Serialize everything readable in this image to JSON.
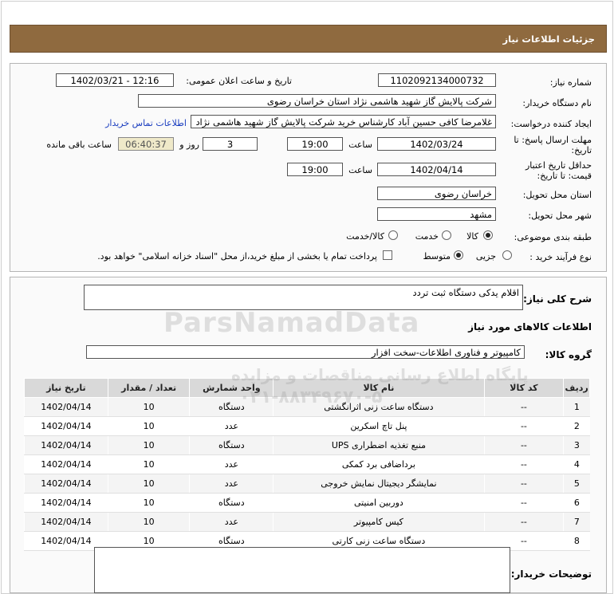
{
  "header": {
    "title": "جزئیات اطلاعات نیاز"
  },
  "form": {
    "need_number_label": "شماره نیاز:",
    "need_number": "1102092134000732",
    "announce_label": "تاریخ و ساعت اعلان عمومی:",
    "announce_value": "1402/03/21 - 12:16",
    "buyer_label": "نام دستگاه خریدار:",
    "buyer_value": "شرکت پالایش گاز شهید هاشمی نژاد   استان خراسان رضوی",
    "creator_label": "ایجاد کننده درخواست:",
    "creator_value": "غلامرضا کافی حسین آباد کارشناس خرید  شرکت پالایش گاز شهید هاشمی نژاد",
    "contact_link": "اطلاعات تماس خریدار",
    "deadline_label_1": "مهلت ارسال پاسخ: تا",
    "deadline_label_2": "تاریخ:",
    "deadline_date": "1402/03/24",
    "time_label": "ساعت",
    "deadline_time": "19:00",
    "days_value": "3",
    "days_label": "روز و",
    "remaining_time": "06:40:37",
    "remaining_label": "ساعت باقی مانده",
    "validity_label_1": "حداقل تاریخ اعتبار",
    "validity_label_2": "قیمت: تا تاریخ:",
    "validity_date": "1402/04/14",
    "validity_time": "19:00",
    "province_label": "استان محل تحویل:",
    "province_value": "خراسان رضوی",
    "city_label": "شهر محل تحویل:",
    "city_value": "مشهد",
    "category_label": "طبقه بندی موضوعی:",
    "category_options": [
      "کالا",
      "خدمت",
      "کالا/خدمت"
    ],
    "process_label": "نوع فرآیند خرید :",
    "process_options": [
      "جزیی",
      "متوسط"
    ],
    "payment_note": "پرداخت تمام یا بخشی از مبلغ خرید،از محل \"اسناد خزانه اسلامی\" خواهد بود."
  },
  "summary": {
    "desc_label": "شرح کلی نیاز:",
    "desc_value": "اقلام یدکی دستگاه ثبت تردد",
    "items_info_label": "اطلاعات کالاهای مورد نیاز",
    "group_label": "گروه کالا:",
    "group_value": "کامپیوتر و فناوری اطلاعات-سخت افزار",
    "columns": [
      "ردیف",
      "کد کالا",
      "نام کالا",
      "واحد شمارش",
      "تعداد / مقدار",
      "تاریخ نیاز"
    ],
    "rows": [
      [
        "1",
        "--",
        "دستگاه ساعت زنی اثرانگشتی",
        "دستگاه",
        "10",
        "1402/04/14"
      ],
      [
        "2",
        "--",
        "پنل تاچ اسکرین",
        "عدد",
        "10",
        "1402/04/14"
      ],
      [
        "3",
        "--",
        "منبع تغذیه اضطراری UPS",
        "دستگاه",
        "10",
        "1402/04/14"
      ],
      [
        "4",
        "--",
        "برداضافی برد کمکی",
        "عدد",
        "10",
        "1402/04/14"
      ],
      [
        "5",
        "--",
        "نمایشگر دیجیتال نمایش خروجی",
        "عدد",
        "10",
        "1402/04/14"
      ],
      [
        "6",
        "--",
        "دوربین امنیتی",
        "دستگاه",
        "10",
        "1402/04/14"
      ],
      [
        "7",
        "--",
        "کیس کامپیوتر",
        "عدد",
        "10",
        "1402/04/14"
      ],
      [
        "8",
        "--",
        "دستگاه ساعت زنی کارتی",
        "دستگاه",
        "10",
        "1402/04/14"
      ]
    ],
    "buyer_notes_label": "توضیحات خریدار:",
    "buyer_notes_value": ""
  },
  "watermark": {
    "brand": "ParsNamadData",
    "line1": "پایگاه اطلاع رسانی مناقصات و مزایده",
    "phone": "۰۲۱-۸۸۳۴۹۶۷۰-۵"
  }
}
